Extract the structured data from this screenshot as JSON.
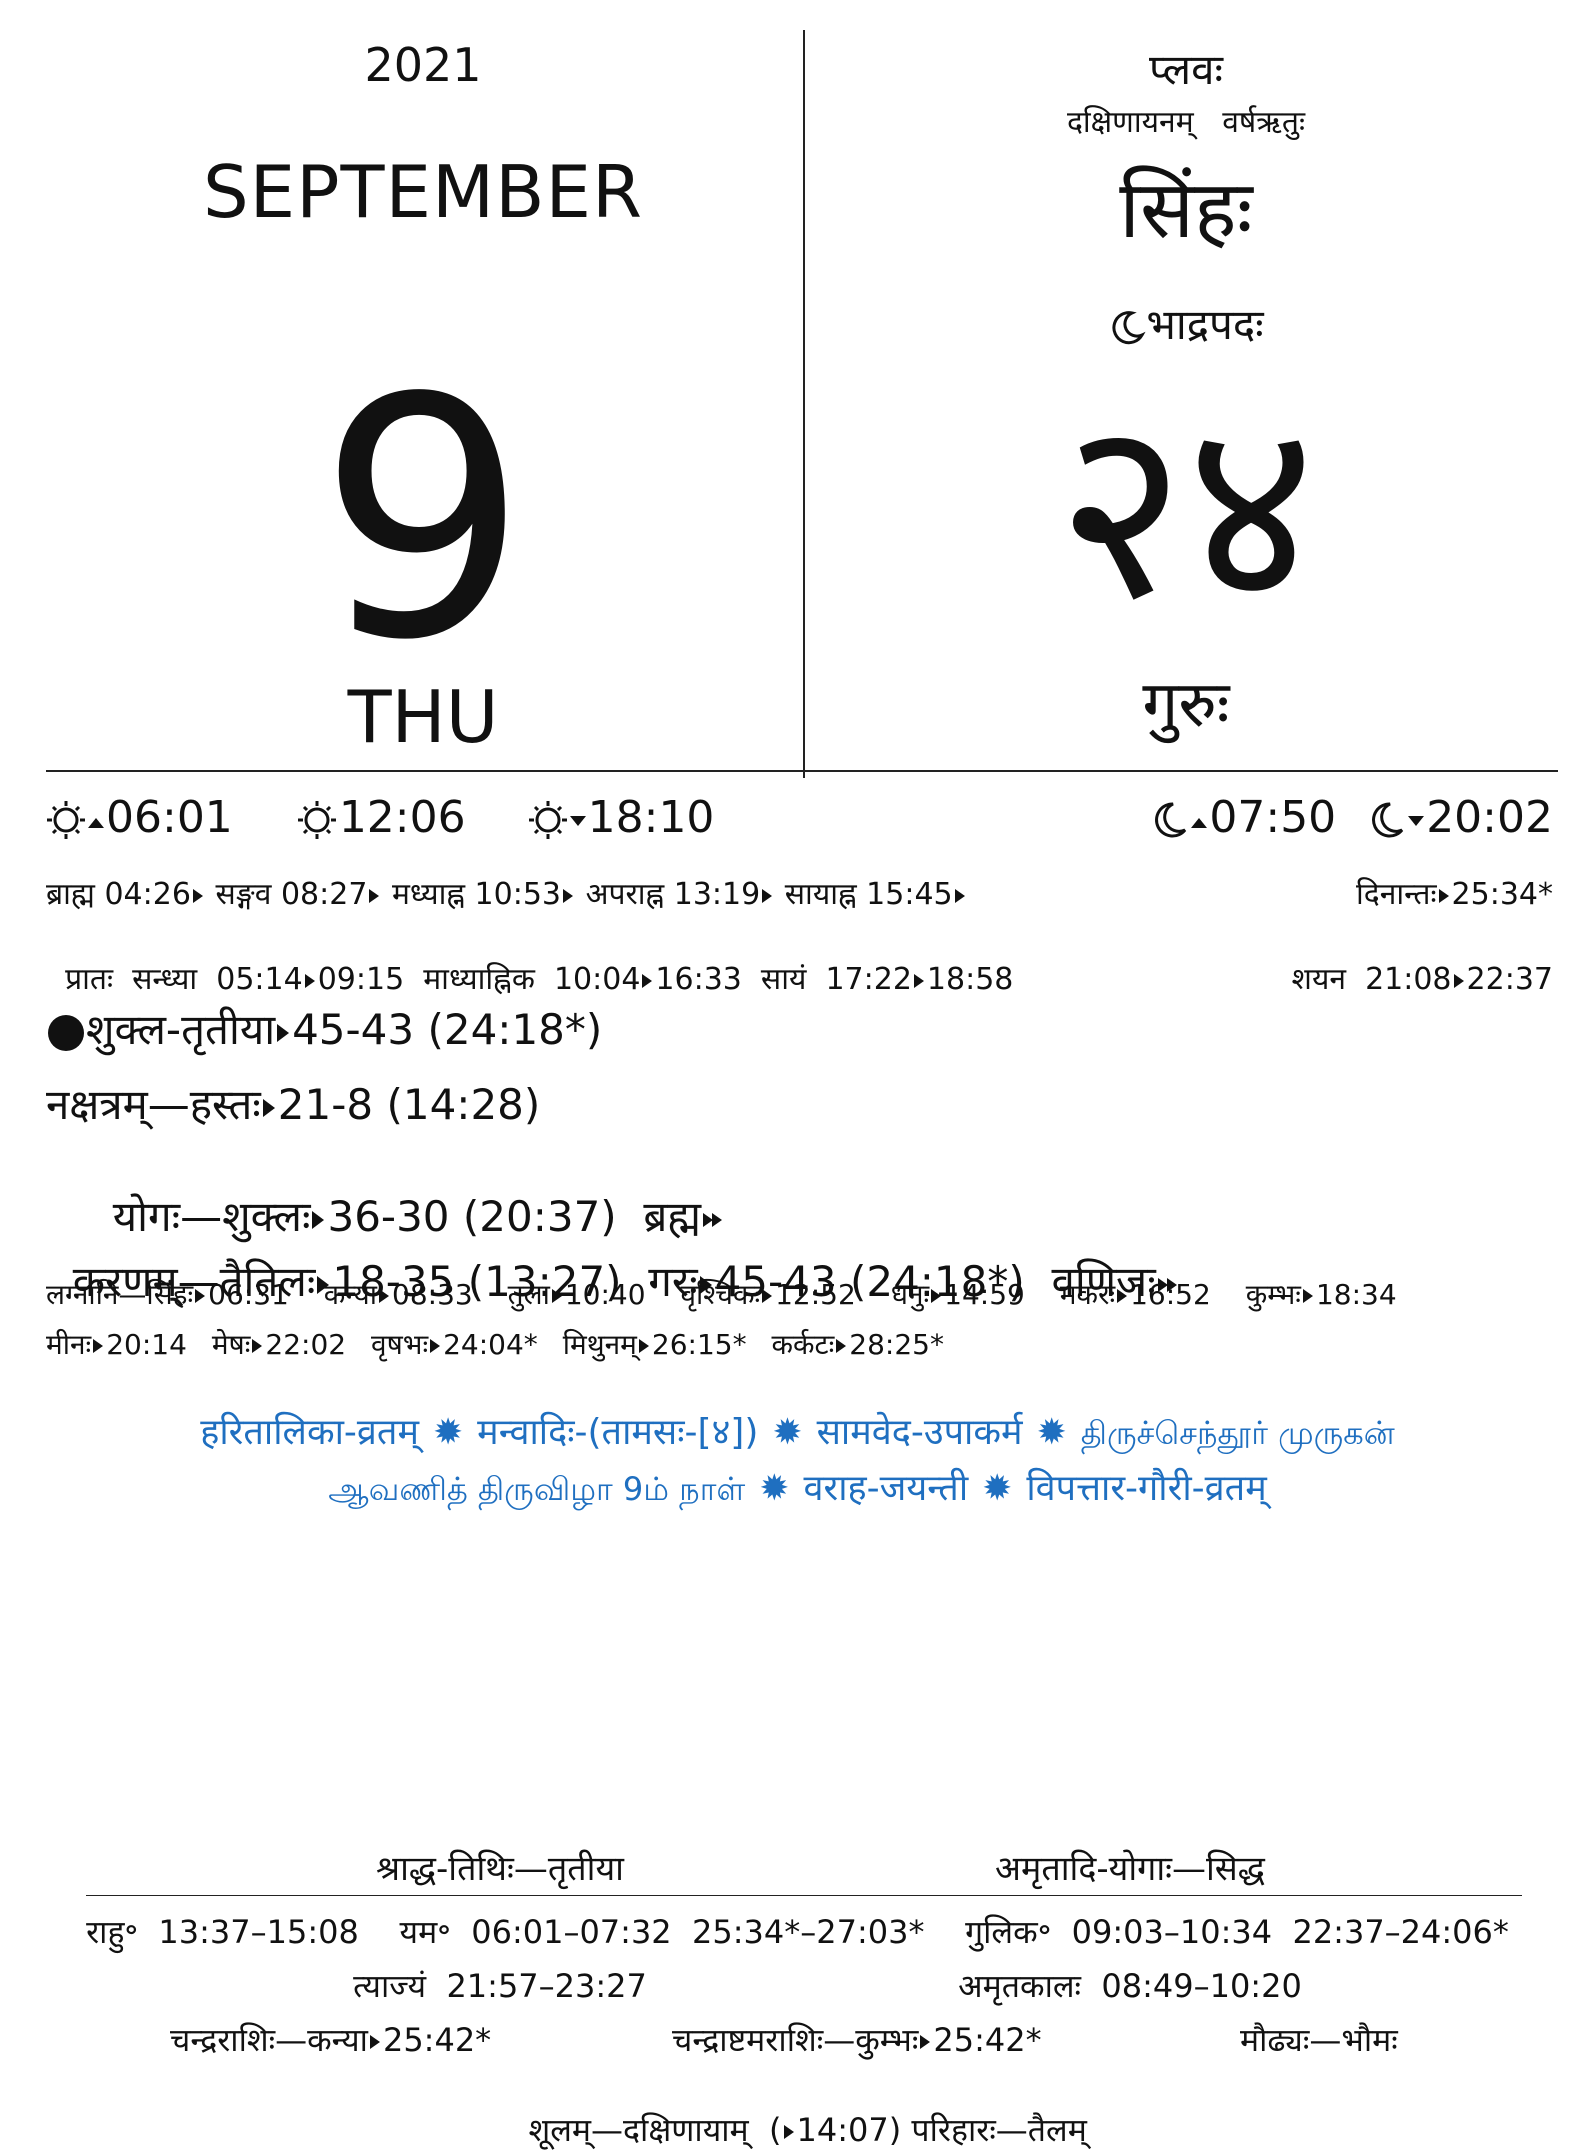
{
  "header": {
    "year": "2021",
    "month": "SEPTEMBER",
    "day": "9",
    "weekday": "THU",
    "samvatsara": "प्लवः",
    "ayana_ritu": "दक्षिणायनम्   वर्षऋतुः",
    "solar_month": "सिंहः",
    "lunar_month": "भाद्रपदः",
    "lunar_day": "२४",
    "vasara": "गुरुः"
  },
  "times": {
    "sunrise": "06:01",
    "noon": "12:06",
    "sunset": "18:10",
    "moonrise": "07:50",
    "moonset": "20:02"
  },
  "periods": {
    "line1": [
      "ब्राह्म 04:26",
      "सङ्गव 08:27",
      "मध्याह्न 10:53",
      "अपराह्न 13:19",
      "सायाह्न 15:45"
    ],
    "dinanta": "दिनान्तः",
    "dinanta_time": "25:34*",
    "pratah": "प्रातः  सन्ध्या  05:14",
    "pratah_end": "09:15  माध्याह्निक  10:04",
    "madhya_end": "16:33  सायं  17:22",
    "sayam_end": "18:58",
    "shayana": "शयन  21:08",
    "shayana_end": "22:37"
  },
  "panchanga": {
    "tithi": "शुक्ल-तृतीया",
    "tithi_end": "45-43 (24:18*)",
    "nakshatra": "नक्षत्रम्—हस्तः",
    "nakshatra_end": "21-8 (14:28)",
    "yoga": "योगः—शुक्लः",
    "yoga_end": "36-30 (20:37)  ब्रह्म",
    "karana": "करणम्—तैतिलः",
    "karana_end": "18-35 (13:27)  गरः",
    "karana2_end": "45-43 (24:18*)  वणिजः"
  },
  "lagnas": {
    "row1": [
      {
        "name": "लग्नानि—सिंहः",
        "time": "06:31"
      },
      {
        "name": "कन्या",
        "time": "08:33"
      },
      {
        "name": "तुला",
        "time": "10:40"
      },
      {
        "name": "वृश्चिकः",
        "time": "12:52"
      },
      {
        "name": "धनुः",
        "time": "14:59"
      },
      {
        "name": "मकरः",
        "time": "16:52"
      },
      {
        "name": "कुम्भः",
        "time": "18:34"
      }
    ],
    "row2": [
      {
        "name": "मीनः",
        "time": "20:14"
      },
      {
        "name": "मेषः",
        "time": "22:02"
      },
      {
        "name": "वृषभः",
        "time": "24:04*"
      },
      {
        "name": "मिथुनम्",
        "time": "26:15*"
      },
      {
        "name": "कर्कटः",
        "time": "28:25*"
      }
    ]
  },
  "festivals": {
    "line1": [
      "हरितालिका-व्रतम्",
      "मन्वादिः-(तामसः-[४])",
      "सामवेद-उपाकर्म",
      "திருச்செந்தூர் முருகன்"
    ],
    "line2": [
      "ஆவணித் திருவிழா 9ம் நாள்",
      "वराह-जयन्ती",
      "विपत्तार-गौरी-व्रतम्"
    ],
    "color": "#1f6fc0"
  },
  "footer": {
    "shraddha": "श्राद्ध-तिथिः—तृतीया",
    "amritadi": "अमृतादि-योगाः—सिद्ध",
    "rahu": "राहु॰  13:37–15:08    यम॰  06:01–07:32  25:34*–27:03*    गुलिक॰  09:03–10:34  22:37–24:06*",
    "tyajya": "त्याज्यं  21:57–23:27",
    "amritakala": "अमृतकालः  08:49–10:20",
    "chandrarashi": "चन्द्रराशिः—कन्या",
    "chandrarashi_time": "25:42*",
    "ashtama": "चन्द्राष्टमराशिः—कुम्भः",
    "ashtama_time": "25:42*",
    "maudhya": "मौढ्यः—भौमः",
    "shoola": "शूलम्—दक्षिणायाम्  (",
    "shoola_time": "14:07) परिहारः—तैलम्"
  }
}
